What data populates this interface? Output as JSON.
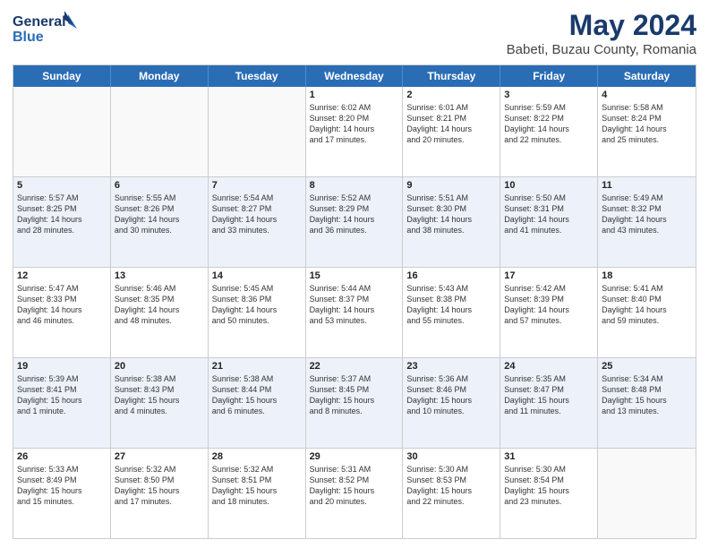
{
  "header": {
    "logo_general": "General",
    "logo_blue": "Blue",
    "month_title": "May 2024",
    "location": "Babeti, Buzau County, Romania"
  },
  "weekdays": [
    "Sunday",
    "Monday",
    "Tuesday",
    "Wednesday",
    "Thursday",
    "Friday",
    "Saturday"
  ],
  "rows": [
    {
      "alt": false,
      "cells": [
        {
          "day": "",
          "text": "",
          "empty": true
        },
        {
          "day": "",
          "text": "",
          "empty": true
        },
        {
          "day": "",
          "text": "",
          "empty": true
        },
        {
          "day": "1",
          "text": "Sunrise: 6:02 AM\nSunset: 8:20 PM\nDaylight: 14 hours\nand 17 minutes.",
          "empty": false
        },
        {
          "day": "2",
          "text": "Sunrise: 6:01 AM\nSunset: 8:21 PM\nDaylight: 14 hours\nand 20 minutes.",
          "empty": false
        },
        {
          "day": "3",
          "text": "Sunrise: 5:59 AM\nSunset: 8:22 PM\nDaylight: 14 hours\nand 22 minutes.",
          "empty": false
        },
        {
          "day": "4",
          "text": "Sunrise: 5:58 AM\nSunset: 8:24 PM\nDaylight: 14 hours\nand 25 minutes.",
          "empty": false
        }
      ]
    },
    {
      "alt": true,
      "cells": [
        {
          "day": "5",
          "text": "Sunrise: 5:57 AM\nSunset: 8:25 PM\nDaylight: 14 hours\nand 28 minutes.",
          "empty": false
        },
        {
          "day": "6",
          "text": "Sunrise: 5:55 AM\nSunset: 8:26 PM\nDaylight: 14 hours\nand 30 minutes.",
          "empty": false
        },
        {
          "day": "7",
          "text": "Sunrise: 5:54 AM\nSunset: 8:27 PM\nDaylight: 14 hours\nand 33 minutes.",
          "empty": false
        },
        {
          "day": "8",
          "text": "Sunrise: 5:52 AM\nSunset: 8:29 PM\nDaylight: 14 hours\nand 36 minutes.",
          "empty": false
        },
        {
          "day": "9",
          "text": "Sunrise: 5:51 AM\nSunset: 8:30 PM\nDaylight: 14 hours\nand 38 minutes.",
          "empty": false
        },
        {
          "day": "10",
          "text": "Sunrise: 5:50 AM\nSunset: 8:31 PM\nDaylight: 14 hours\nand 41 minutes.",
          "empty": false
        },
        {
          "day": "11",
          "text": "Sunrise: 5:49 AM\nSunset: 8:32 PM\nDaylight: 14 hours\nand 43 minutes.",
          "empty": false
        }
      ]
    },
    {
      "alt": false,
      "cells": [
        {
          "day": "12",
          "text": "Sunrise: 5:47 AM\nSunset: 8:33 PM\nDaylight: 14 hours\nand 46 minutes.",
          "empty": false
        },
        {
          "day": "13",
          "text": "Sunrise: 5:46 AM\nSunset: 8:35 PM\nDaylight: 14 hours\nand 48 minutes.",
          "empty": false
        },
        {
          "day": "14",
          "text": "Sunrise: 5:45 AM\nSunset: 8:36 PM\nDaylight: 14 hours\nand 50 minutes.",
          "empty": false
        },
        {
          "day": "15",
          "text": "Sunrise: 5:44 AM\nSunset: 8:37 PM\nDaylight: 14 hours\nand 53 minutes.",
          "empty": false
        },
        {
          "day": "16",
          "text": "Sunrise: 5:43 AM\nSunset: 8:38 PM\nDaylight: 14 hours\nand 55 minutes.",
          "empty": false
        },
        {
          "day": "17",
          "text": "Sunrise: 5:42 AM\nSunset: 8:39 PM\nDaylight: 14 hours\nand 57 minutes.",
          "empty": false
        },
        {
          "day": "18",
          "text": "Sunrise: 5:41 AM\nSunset: 8:40 PM\nDaylight: 14 hours\nand 59 minutes.",
          "empty": false
        }
      ]
    },
    {
      "alt": true,
      "cells": [
        {
          "day": "19",
          "text": "Sunrise: 5:39 AM\nSunset: 8:41 PM\nDaylight: 15 hours\nand 1 minute.",
          "empty": false
        },
        {
          "day": "20",
          "text": "Sunrise: 5:38 AM\nSunset: 8:43 PM\nDaylight: 15 hours\nand 4 minutes.",
          "empty": false
        },
        {
          "day": "21",
          "text": "Sunrise: 5:38 AM\nSunset: 8:44 PM\nDaylight: 15 hours\nand 6 minutes.",
          "empty": false
        },
        {
          "day": "22",
          "text": "Sunrise: 5:37 AM\nSunset: 8:45 PM\nDaylight: 15 hours\nand 8 minutes.",
          "empty": false
        },
        {
          "day": "23",
          "text": "Sunrise: 5:36 AM\nSunset: 8:46 PM\nDaylight: 15 hours\nand 10 minutes.",
          "empty": false
        },
        {
          "day": "24",
          "text": "Sunrise: 5:35 AM\nSunset: 8:47 PM\nDaylight: 15 hours\nand 11 minutes.",
          "empty": false
        },
        {
          "day": "25",
          "text": "Sunrise: 5:34 AM\nSunset: 8:48 PM\nDaylight: 15 hours\nand 13 minutes.",
          "empty": false
        }
      ]
    },
    {
      "alt": false,
      "cells": [
        {
          "day": "26",
          "text": "Sunrise: 5:33 AM\nSunset: 8:49 PM\nDaylight: 15 hours\nand 15 minutes.",
          "empty": false
        },
        {
          "day": "27",
          "text": "Sunrise: 5:32 AM\nSunset: 8:50 PM\nDaylight: 15 hours\nand 17 minutes.",
          "empty": false
        },
        {
          "day": "28",
          "text": "Sunrise: 5:32 AM\nSunset: 8:51 PM\nDaylight: 15 hours\nand 18 minutes.",
          "empty": false
        },
        {
          "day": "29",
          "text": "Sunrise: 5:31 AM\nSunset: 8:52 PM\nDaylight: 15 hours\nand 20 minutes.",
          "empty": false
        },
        {
          "day": "30",
          "text": "Sunrise: 5:30 AM\nSunset: 8:53 PM\nDaylight: 15 hours\nand 22 minutes.",
          "empty": false
        },
        {
          "day": "31",
          "text": "Sunrise: 5:30 AM\nSunset: 8:54 PM\nDaylight: 15 hours\nand 23 minutes.",
          "empty": false
        },
        {
          "day": "",
          "text": "",
          "empty": true
        }
      ]
    }
  ]
}
